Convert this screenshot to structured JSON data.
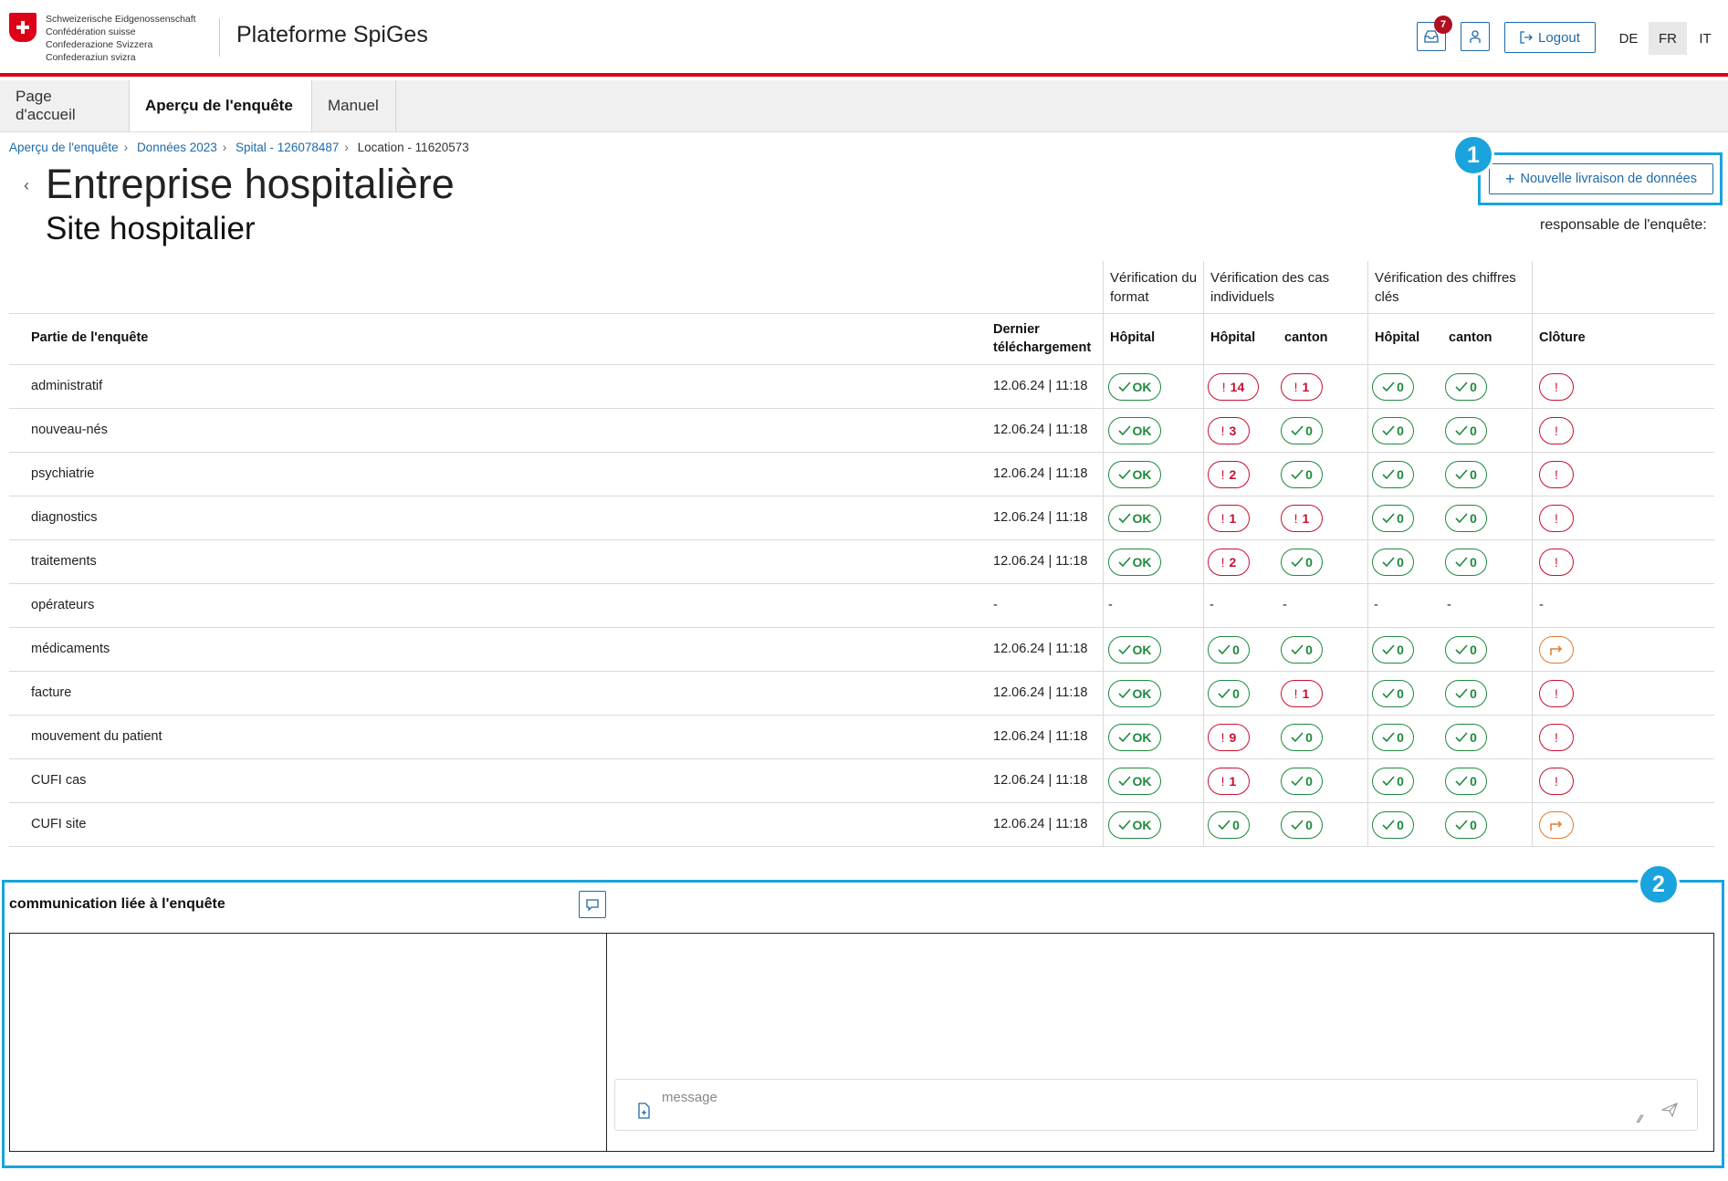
{
  "header": {
    "confederation_lines": [
      "Schweizerische Eidgenossenschaft",
      "Confédération suisse",
      "Confederazione Svizzera",
      "Confederaziun svizra"
    ],
    "app_title": "Plateforme SpiGes",
    "notification_count": "7",
    "logout_label": "Logout",
    "languages": [
      "DE",
      "FR",
      "IT"
    ],
    "active_language": "FR",
    "brand_color": "#dc0018",
    "accent_color": "#1e6aa8"
  },
  "nav": {
    "tabs": [
      {
        "label": "Page d'accueil",
        "active": false
      },
      {
        "label": "Aperçu de l'enquête",
        "active": true
      },
      {
        "label": "Manuel",
        "active": false
      }
    ]
  },
  "breadcrumb": {
    "items": [
      "Aperçu de l'enquête",
      "Données 2023",
      "Spital - 126078487",
      "Location - 11620573"
    ],
    "separator": "›"
  },
  "page": {
    "title": "Entreprise hospitalière",
    "subtitle": "Site hospitalier",
    "new_delivery_label": "Nouvelle livraison de données",
    "responsible_label": "responsable de l'enquête:",
    "back_icon": "chevron-left-icon"
  },
  "annotations": {
    "marker_1": "1",
    "marker_2": "2",
    "highlight_color": "#1aa3dd"
  },
  "table": {
    "group_headers": {
      "format": "Vérification du format",
      "cases": "Vérification des cas individuels",
      "keyfigures": "Vérification des chiffres clés"
    },
    "columns": {
      "part": "Partie de l'enquête",
      "last_upload": "Dernier téléchargement",
      "hospital": "Hôpital",
      "canton": "canton",
      "closure": "Clôture"
    },
    "status_colors": {
      "ok": "#1e8a3c",
      "error": "#c8102e",
      "forward": "#e07a30"
    },
    "rows": [
      {
        "name": "administratif",
        "date": "12.06.24 | 11:18",
        "format": "OK",
        "cases_h": [
          "err",
          "14"
        ],
        "cases_c": [
          "err",
          "1"
        ],
        "kf_h": [
          "ok",
          "0"
        ],
        "kf_c": [
          "ok",
          "0"
        ],
        "closure": "err"
      },
      {
        "name": "nouveau-nés",
        "date": "12.06.24 | 11:18",
        "format": "OK",
        "cases_h": [
          "err",
          "3"
        ],
        "cases_c": [
          "ok",
          "0"
        ],
        "kf_h": [
          "ok",
          "0"
        ],
        "kf_c": [
          "ok",
          "0"
        ],
        "closure": "err"
      },
      {
        "name": "psychiatrie",
        "date": "12.06.24 | 11:18",
        "format": "OK",
        "cases_h": [
          "err",
          "2"
        ],
        "cases_c": [
          "ok",
          "0"
        ],
        "kf_h": [
          "ok",
          "0"
        ],
        "kf_c": [
          "ok",
          "0"
        ],
        "closure": "err"
      },
      {
        "name": "diagnostics",
        "date": "12.06.24 | 11:18",
        "format": "OK",
        "cases_h": [
          "err",
          "1"
        ],
        "cases_c": [
          "err",
          "1"
        ],
        "kf_h": [
          "ok",
          "0"
        ],
        "kf_c": [
          "ok",
          "0"
        ],
        "closure": "err"
      },
      {
        "name": "traitements",
        "date": "12.06.24 | 11:18",
        "format": "OK",
        "cases_h": [
          "err",
          "2"
        ],
        "cases_c": [
          "ok",
          "0"
        ],
        "kf_h": [
          "ok",
          "0"
        ],
        "kf_c": [
          "ok",
          "0"
        ],
        "closure": "err"
      },
      {
        "name": "opérateurs",
        "date": "-",
        "format": "-",
        "cases_h": [
          "none",
          "-"
        ],
        "cases_c": [
          "none",
          "-"
        ],
        "kf_h": [
          "none",
          "-"
        ],
        "kf_c": [
          "none",
          "-"
        ],
        "closure": "-"
      },
      {
        "name": "médicaments",
        "date": "12.06.24 | 11:18",
        "format": "OK",
        "cases_h": [
          "ok",
          "0"
        ],
        "cases_c": [
          "ok",
          "0"
        ],
        "kf_h": [
          "ok",
          "0"
        ],
        "kf_c": [
          "ok",
          "0"
        ],
        "closure": "fwd"
      },
      {
        "name": "facture",
        "date": "12.06.24 | 11:18",
        "format": "OK",
        "cases_h": [
          "ok",
          "0"
        ],
        "cases_c": [
          "err",
          "1"
        ],
        "kf_h": [
          "ok",
          "0"
        ],
        "kf_c": [
          "ok",
          "0"
        ],
        "closure": "err"
      },
      {
        "name": "mouvement du patient",
        "date": "12.06.24 | 11:18",
        "format": "OK",
        "cases_h": [
          "err",
          "9"
        ],
        "cases_c": [
          "ok",
          "0"
        ],
        "kf_h": [
          "ok",
          "0"
        ],
        "kf_c": [
          "ok",
          "0"
        ],
        "closure": "err"
      },
      {
        "name": "CUFI cas",
        "date": "12.06.24 | 11:18",
        "format": "OK",
        "cases_h": [
          "err",
          "1"
        ],
        "cases_c": [
          "ok",
          "0"
        ],
        "kf_h": [
          "ok",
          "0"
        ],
        "kf_c": [
          "ok",
          "0"
        ],
        "closure": "err"
      },
      {
        "name": "CUFI site",
        "date": "12.06.24 | 11:18",
        "format": "OK",
        "cases_h": [
          "ok",
          "0"
        ],
        "cases_c": [
          "ok",
          "0"
        ],
        "kf_h": [
          "ok",
          "0"
        ],
        "kf_c": [
          "ok",
          "0"
        ],
        "closure": "fwd"
      }
    ]
  },
  "communication": {
    "title": "communication liée à l'enquête",
    "message_placeholder": "message"
  }
}
